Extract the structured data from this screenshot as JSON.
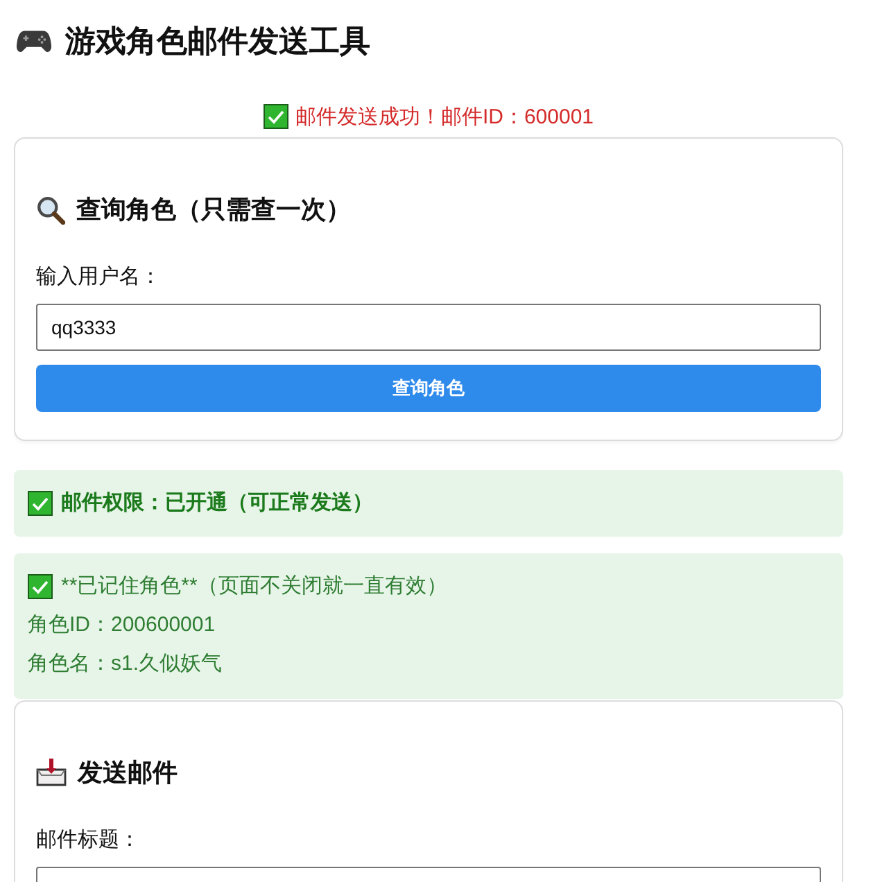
{
  "header": {
    "title": "游戏角色邮件发送工具"
  },
  "result_message": {
    "kind": "success",
    "text": "邮件发送成功！邮件ID：600001"
  },
  "query_card": {
    "heading": "查询角色（只需查一次）",
    "fields": [
      {
        "label": "输入用户名：",
        "value": "qq3333"
      }
    ],
    "button": "查询角色"
  },
  "notices": [
    {
      "kind": "permission",
      "lines": [
        "邮件权限：已开通（可正常发送）"
      ]
    },
    {
      "kind": "character",
      "lines": [
        "**已记住角色**（页面不关闭就一直有效）",
        "角色ID：200600001",
        "角色名：s1.久似妖气"
      ]
    }
  ],
  "send_card": {
    "heading": "发送邮件",
    "fields": [
      {
        "label": "邮件标题："
      }
    ]
  }
}
